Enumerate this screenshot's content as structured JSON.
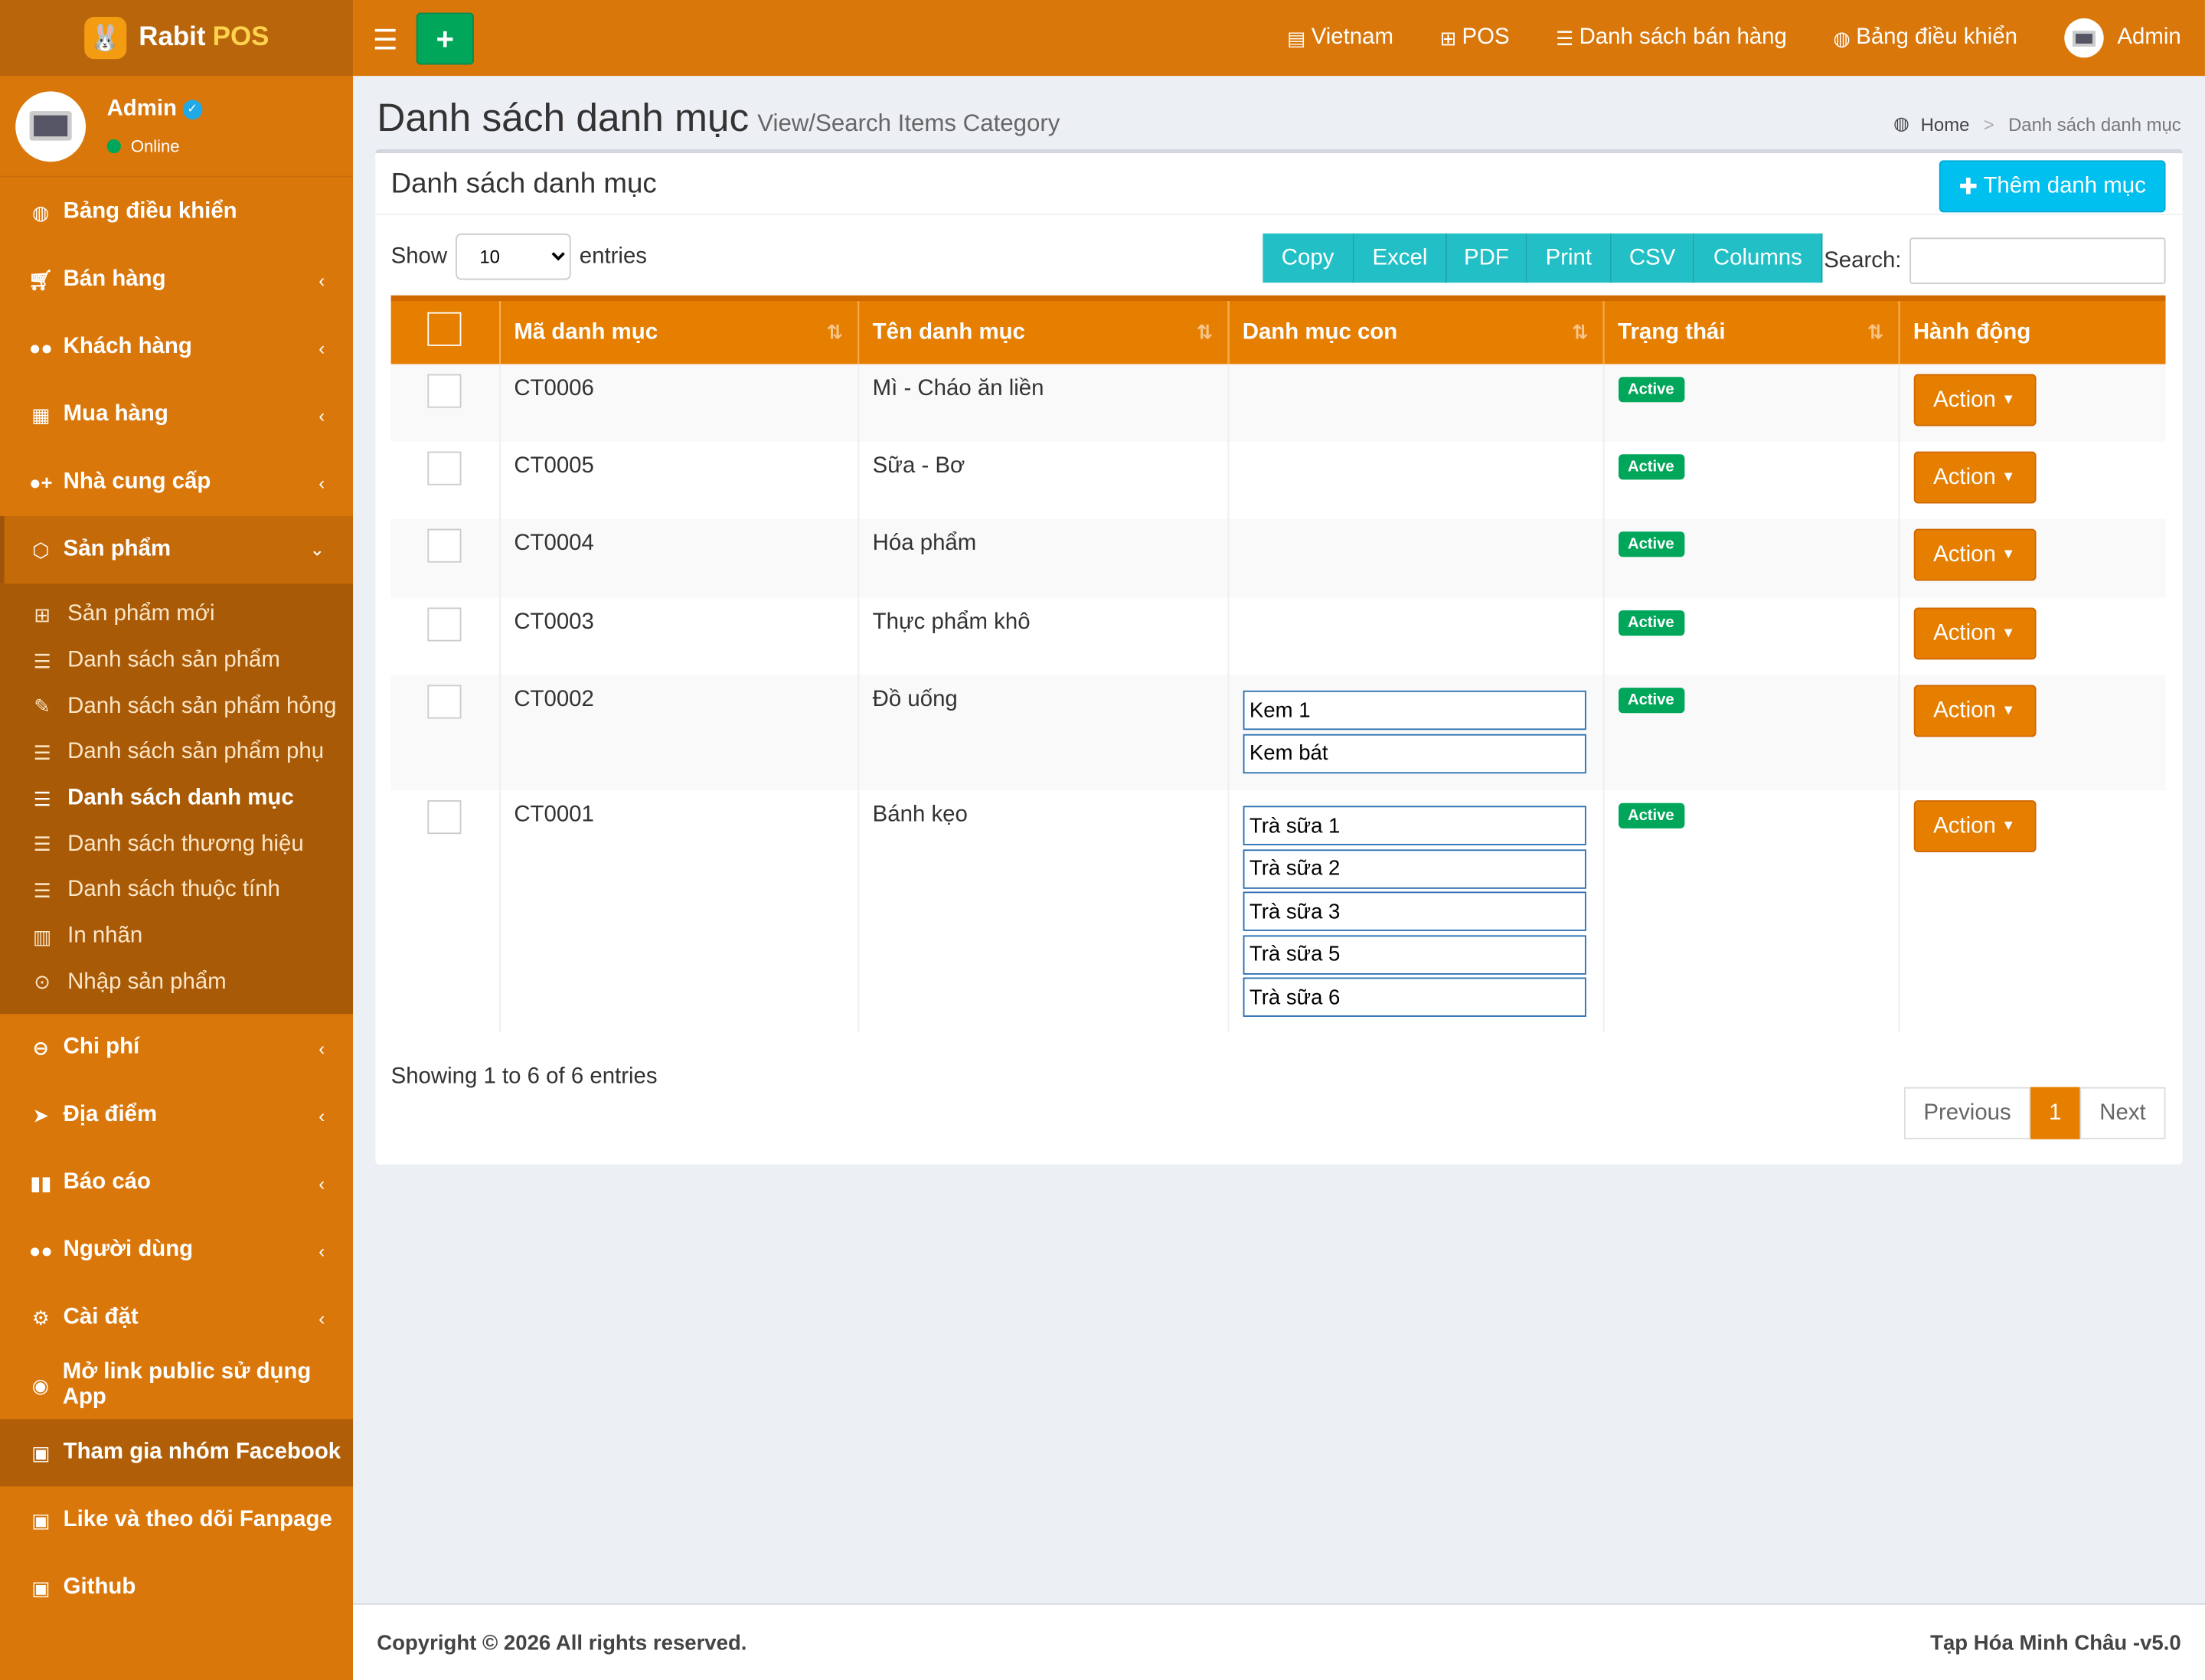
{
  "brand": {
    "name": "Rabit",
    "name_accent": "POS"
  },
  "user": {
    "name": "Admin",
    "status": "Online"
  },
  "sidebar": {
    "items": [
      {
        "label": "Bảng điều khiển",
        "icon": "dashboard-icon"
      },
      {
        "label": "Bán hàng",
        "icon": "cart-icon"
      },
      {
        "label": "Khách hàng",
        "icon": "users-icon"
      },
      {
        "label": "Mua hàng",
        "icon": "grid-icon"
      },
      {
        "label": "Nhà cung cấp",
        "icon": "user-plus-icon"
      },
      {
        "label": "Sản phẩm",
        "icon": "cubes-icon"
      }
    ],
    "sub_items": [
      {
        "label": "Sản phẩm mới"
      },
      {
        "label": "Danh sách sản phẩm"
      },
      {
        "label": "Danh sách sản phẩm hỏng"
      },
      {
        "label": "Danh sách sản phẩm phụ"
      },
      {
        "label": "Danh sách danh mục"
      },
      {
        "label": "Danh sách thương hiệu"
      },
      {
        "label": "Danh sách thuộc tính"
      },
      {
        "label": "In nhãn"
      },
      {
        "label": "Nhập sản phẩm"
      }
    ],
    "items2": [
      {
        "label": "Chi phí"
      },
      {
        "label": "Địa điểm"
      },
      {
        "label": "Báo cáo"
      },
      {
        "label": "Người dùng"
      },
      {
        "label": "Cài đặt"
      },
      {
        "label": "Mở link public sử dụng App"
      },
      {
        "label": "Tham gia nhóm Facebook"
      },
      {
        "label": "Like và theo dõi Fanpage"
      },
      {
        "label": "Github"
      }
    ]
  },
  "topnav": {
    "lang": "Vietnam",
    "pos": "POS",
    "sales": "Danh sách bán hàng",
    "dash": "Bảng điều khiển",
    "user": "Admin"
  },
  "page": {
    "title": "Danh sách danh mục",
    "subtitle": "View/Search Items Category",
    "breadcrumb_home": "Home",
    "breadcrumb_current": "Danh sách danh mục"
  },
  "box": {
    "title": "Danh sách danh mục",
    "add_button": "Thêm danh mục"
  },
  "controls": {
    "show": "Show",
    "entries_value": "10",
    "entries": "entries",
    "search": "Search:"
  },
  "export_buttons": [
    "Copy",
    "Excel",
    "PDF",
    "Print",
    "CSV",
    "Columns"
  ],
  "table": {
    "headers": [
      "Mã danh mục",
      "Tên danh mục",
      "Danh mục con",
      "Trạng thái",
      "Hành động"
    ],
    "rows": [
      {
        "code": "CT0006",
        "name": "Mì - Cháo ăn liền",
        "subs": [],
        "status": "Active",
        "action": "Action"
      },
      {
        "code": "CT0005",
        "name": "Sữa - Bơ",
        "subs": [],
        "status": "Active",
        "action": "Action"
      },
      {
        "code": "CT0004",
        "name": "Hóa phẩm",
        "subs": [],
        "status": "Active",
        "action": "Action"
      },
      {
        "code": "CT0003",
        "name": "Thực phẩm khô",
        "subs": [],
        "status": "Active",
        "action": "Action"
      },
      {
        "code": "CT0002",
        "name": "Đồ uống",
        "subs": [
          "Kem 1",
          "Kem bát"
        ],
        "status": "Active",
        "action": "Action"
      },
      {
        "code": "CT0001",
        "name": "Bánh kẹo",
        "subs": [
          "Trà sữa 1",
          "Trà sữa 2",
          "Trà sữa 3",
          "Trà sữa 5",
          "Trà sữa 6"
        ],
        "status": "Active",
        "action": "Action"
      }
    ]
  },
  "info": "Showing 1 to 6 of 6 entries",
  "pagination": {
    "prev": "Previous",
    "page": "1",
    "next": "Next"
  },
  "footer": {
    "left": "Copyright © 2026 All rights reserved.",
    "right": "Tạp Hóa Minh Châu -v5.0"
  },
  "colors": {
    "primary": "#d9770a",
    "table_header": "#e67e00",
    "success": "#00a65a",
    "info": "#00c0ef",
    "export": "#22c0c6"
  }
}
